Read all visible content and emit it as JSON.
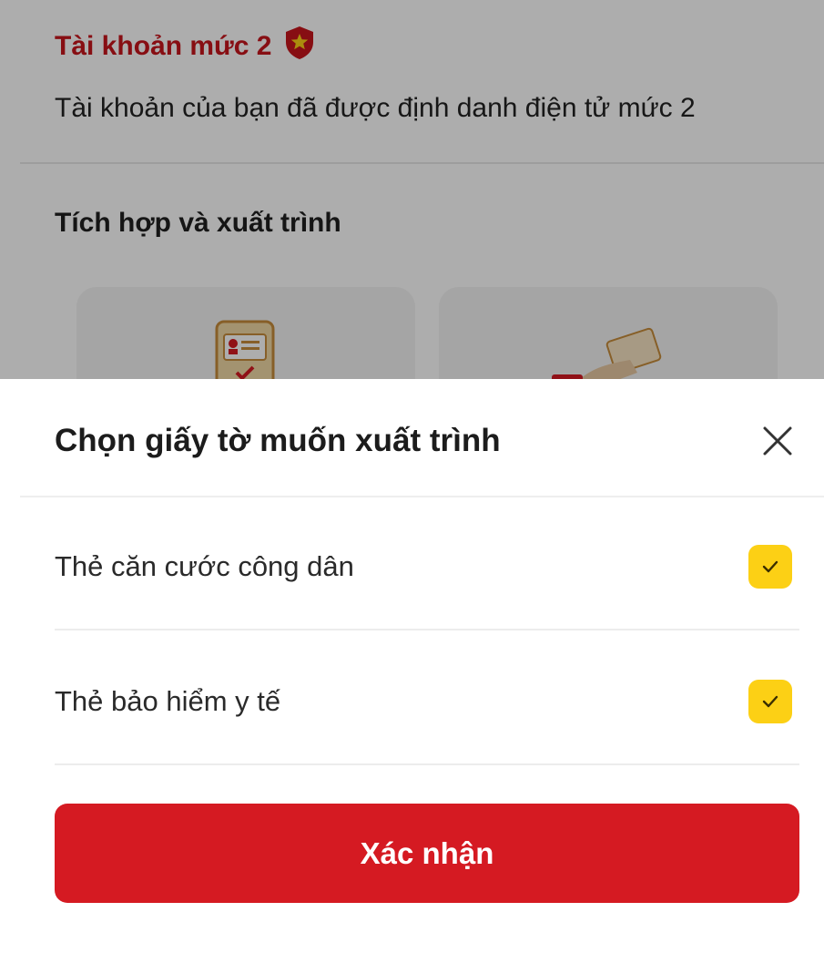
{
  "background": {
    "account_level_title": "Tài khoản mức 2",
    "account_level_description": "Tài khoản của bạn đã được định danh điện tử mức 2",
    "section_title": "Tích hợp và xuất trình",
    "badge_icon": "shield-star-icon",
    "colors": {
      "accent_red": "#c8161d"
    }
  },
  "sheet": {
    "title": "Chọn giấy tờ muốn xuất trình",
    "close_icon": "close-icon",
    "options": [
      {
        "label": "Thẻ căn cước công dân",
        "checked": true
      },
      {
        "label": "Thẻ bảo hiểm y tế",
        "checked": true
      }
    ],
    "confirm_label": "Xác nhận",
    "colors": {
      "button": "#d51a22",
      "checkbox": "#fcd015"
    }
  }
}
